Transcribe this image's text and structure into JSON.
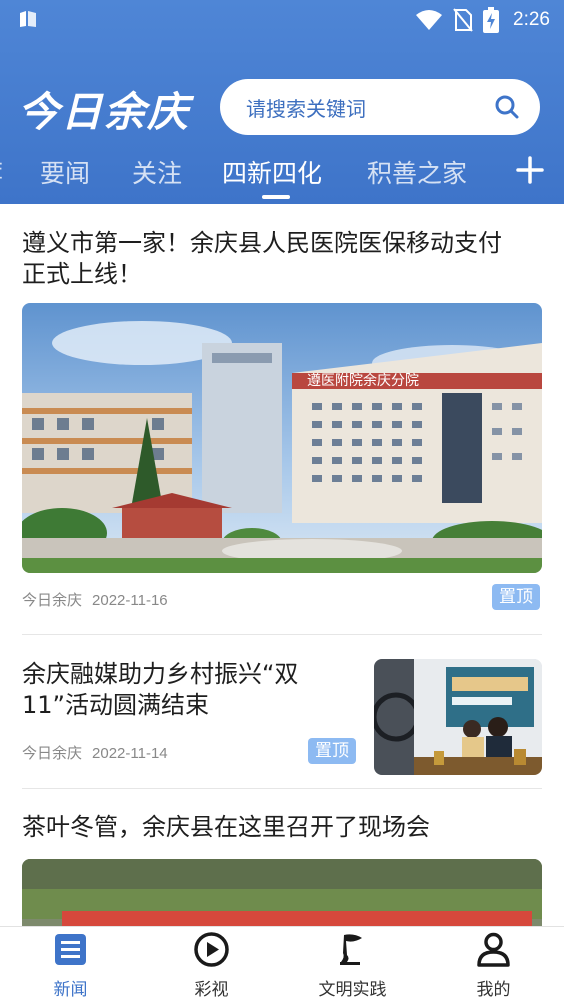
{
  "status_bar": {
    "time": "2:26"
  },
  "header": {
    "logo_text": "今日余庆",
    "search_placeholder": "请搜索关键词",
    "tabs": [
      {
        "label": "要闻"
      },
      {
        "label": "关注"
      },
      {
        "label": "四新四化",
        "active": true
      },
      {
        "label": "积善之家"
      }
    ]
  },
  "feed": [
    {
      "title_lines": [
        "遵义市第一家！余庆县人民医院医保移动支付",
        "正式上线！"
      ],
      "source": "今日余庆",
      "date": "2022-11-16",
      "pin": "置顶",
      "image_text": "遵医附院余庆分院"
    },
    {
      "title_lines": [
        "余庆融媒助力乡村振兴“双",
        "11”活动圆满结束"
      ],
      "source": "今日余庆",
      "date": "2022-11-14",
      "pin": "置顶"
    },
    {
      "title_lines": [
        "茶叶冬管，余庆县在这里召开了现场会"
      ]
    }
  ],
  "bottom_nav": [
    {
      "label": "新闻",
      "icon": "news-icon",
      "active": true
    },
    {
      "label": "彩视",
      "icon": "play-icon"
    },
    {
      "label": "文明实践",
      "icon": "flag-icon"
    },
    {
      "label": "我的",
      "icon": "user-icon"
    }
  ],
  "colors": {
    "header_blue": "#4f86d6",
    "accent_blue": "#3e74c9",
    "pin_bg": "#8dbaf2"
  }
}
